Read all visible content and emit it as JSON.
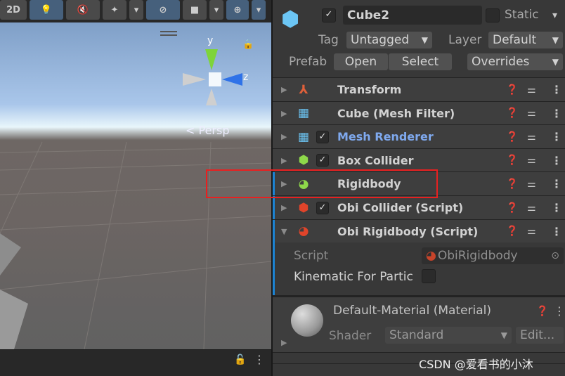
{
  "scene": {
    "toolbar": {
      "btn_2d": "2D"
    },
    "gizmo": {
      "y": "y",
      "z": "z",
      "persp": "Persp"
    }
  },
  "header": {
    "name": "Cube2",
    "static_label": "Static",
    "tag_label": "Tag",
    "tag_value": "Untagged",
    "layer_label": "Layer",
    "layer_value": "Default",
    "prefab_label": "Prefab",
    "open": "Open",
    "select": "Select",
    "overrides": "Overrides",
    "active": true,
    "static": false
  },
  "components": [
    {
      "name": "Transform",
      "icon": "transform-icon",
      "checkbox": false,
      "color": "#d2d2d2"
    },
    {
      "name": "Cube (Mesh Filter)",
      "icon": "mesh-filter-icon",
      "checkbox": false,
      "color": "#d2d2d2"
    },
    {
      "name": "Mesh Renderer",
      "icon": "mesh-renderer-icon",
      "checkbox": true,
      "color": "#7fa9ee"
    },
    {
      "name": "Box Collider",
      "icon": "box-collider-icon",
      "checkbox": true,
      "color": "#d2d2d2"
    },
    {
      "name": "Rigidbody",
      "icon": "rigidbody-icon",
      "checkbox": false,
      "color": "#d2d2d2"
    },
    {
      "name": "Obi Collider (Script)",
      "icon": "obi-collider-icon",
      "checkbox": true,
      "color": "#d2d2d2"
    },
    {
      "name": "Obi Rigidbody (Script)",
      "icon": "obi-rigidbody-icon",
      "checkbox": false,
      "color": "#d2d2d2"
    }
  ],
  "obi_rigidbody": {
    "script_label": "Script",
    "script_value": "ObiRigidbody",
    "kinematic_label": "Kinematic For Partic",
    "kinematic": false
  },
  "material": {
    "title": "Default-Material (Material)",
    "shader_label": "Shader",
    "shader_value": "Standard",
    "edit": "Edit..."
  },
  "watermark": "CSDN @爱看书的小沐",
  "accent": "#1c84d4",
  "highlight": "#e82020"
}
